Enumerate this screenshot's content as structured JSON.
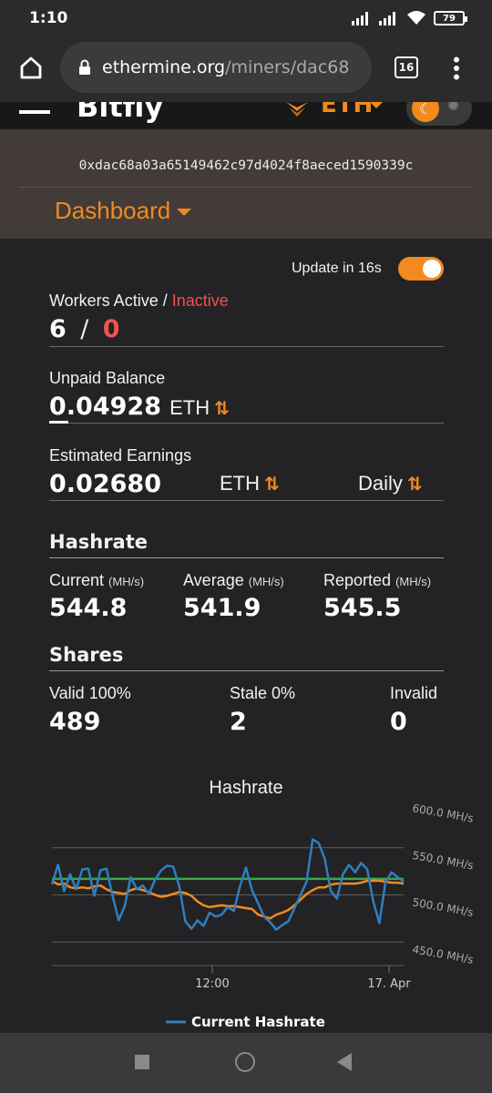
{
  "status_bar": {
    "time": "1:10",
    "battery": "79"
  },
  "browser": {
    "url_host": "ethermine.org",
    "url_path": "/miners/dac68",
    "tab_count": "16"
  },
  "site_header": {
    "brand": "Bitfly",
    "coin": "ETH"
  },
  "miner": {
    "address": "0xdac68a03a65149462c97d4024f8aeced1590339c",
    "dashboard_label": "Dashboard"
  },
  "update": {
    "label": "Update in 16s"
  },
  "workers": {
    "label_active": "Workers Active / ",
    "label_inactive": "Inactive",
    "active": "6",
    "separator": "/",
    "inactive": "0"
  },
  "unpaid": {
    "label": "Unpaid Balance",
    "value": "0.04928",
    "unit": "ETH"
  },
  "estimated": {
    "label": "Estimated Earnings",
    "value": "0.02680",
    "unit": "ETH",
    "period": "Daily"
  },
  "hashrate": {
    "heading": "Hashrate",
    "current_label": "Current",
    "average_label": "Average",
    "reported_label": "Reported",
    "unit": "(MH/s)",
    "current": "544.8",
    "average": "541.9",
    "reported": "545.5"
  },
  "shares": {
    "heading": "Shares",
    "valid_label": "Valid 100%",
    "stale_label": "Stale 0%",
    "invalid_label": "Invalid",
    "valid": "489",
    "stale": "2",
    "invalid": "0"
  },
  "chart_data": {
    "type": "line",
    "title": "Hashrate",
    "y_tick_labels": [
      "600.0 MH/s",
      "550.0 MH/s",
      "500.0 MH/s",
      "450.0 MH/s"
    ],
    "ylim": [
      450,
      600
    ],
    "x_tick_labels": [
      "12:00",
      "17. Apr"
    ],
    "legend": [
      "Current Hashrate"
    ],
    "series": [
      {
        "name": "Current Hashrate",
        "color": "#2f7fc0",
        "values": [
          536,
          557,
          529,
          547,
          531,
          552,
          553,
          524,
          551,
          553,
          524,
          498,
          513,
          544,
          531,
          535,
          526,
          541,
          551,
          556,
          555,
          534,
          497,
          489,
          498,
          492,
          506,
          502,
          504,
          512,
          508,
          534,
          554,
          530,
          516,
          502,
          496,
          488,
          493,
          497,
          511,
          525,
          539,
          584,
          580,
          563,
          529,
          521,
          547,
          557,
          549,
          559,
          552,
          518,
          495,
          538,
          549,
          544,
          539
        ]
      },
      {
        "color": "#f28a1f",
        "values": [
          540,
          536,
          537,
          533,
          532,
          533,
          532,
          534,
          535,
          531,
          528,
          527,
          526,
          530,
          532,
          530,
          528,
          525,
          523,
          524,
          526,
          528,
          527,
          524,
          518,
          514,
          512,
          513,
          514,
          513,
          513,
          512,
          511,
          510,
          504,
          502,
          500,
          504,
          506,
          509,
          514,
          520,
          526,
          530,
          533,
          533,
          536,
          537,
          537,
          537,
          537,
          538,
          540,
          540,
          540,
          539,
          538,
          538,
          537
        ]
      },
      {
        "color": "#38a84a",
        "values": [
          542,
          542,
          542,
          542,
          542,
          542,
          542,
          542,
          542,
          542,
          542,
          542,
          542,
          542,
          542,
          542,
          542,
          542,
          542,
          542,
          542,
          542,
          542,
          542,
          542,
          542,
          542,
          542,
          542,
          542,
          542,
          542,
          542,
          542,
          542,
          542,
          542,
          542,
          542,
          542,
          542,
          542,
          542,
          542,
          542,
          542,
          542,
          542,
          542,
          542,
          542,
          542,
          542,
          542,
          542,
          542,
          542,
          542,
          542
        ]
      }
    ]
  }
}
